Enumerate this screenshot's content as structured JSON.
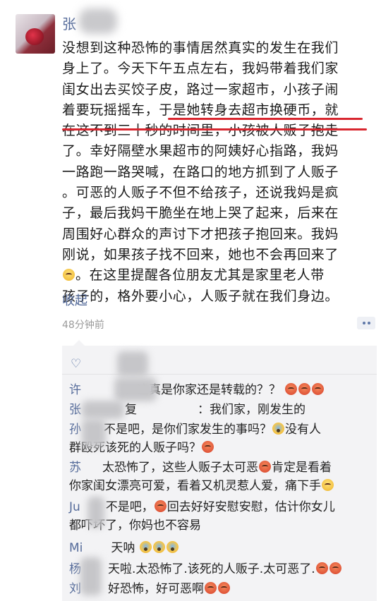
{
  "post": {
    "author_char": "张",
    "lines": [
      "没想到这种恐怖的事情居然真实的发生在我们",
      "身上了。今天下午五点左右，我妈带着我们家",
      "闺女出去买饺子皮，路过一家超市，小孩子闹",
      "着要玩摇摇车，于是她转身去超市换硬币，就",
      "在这不到三十秒的时间里，小孩被人贩子抱走",
      "了。幸好隔壁水果超市的阿姨好心指路，我妈",
      "一路跑一路哭喊，在路口的地方抓到了人贩子",
      "。可恶的人贩子不但不给孩子，还说我妈是疯",
      "子，最后我妈干脆坐在地上哭了起来，后来在",
      "周围好心群众的声讨下才把孩子抱回来。我妈",
      "刚说，如果孩子找不回来，她也不会再回来了",
      "。在这里提醒各位朋友尤其是家里老人带",
      "孩子的，格外要小心，人贩子就在我们身边。"
    ],
    "collapse": "收起",
    "time": "48分钟前"
  },
  "comments": [
    {
      "name": "许",
      "text": "：这真是你家还是转载的？？"
    },
    {
      "name": "张",
      "reply": "复",
      "text": "：我们家，刚发生的"
    },
    {
      "name": "孙",
      "text": "不是吧，是你们家发生的事吗？"
    },
    {
      "name": "",
      "text": "群殴死该死的人贩子吗？"
    },
    {
      "name": "苏",
      "text": "太恐怖了，这些人贩子太可恶"
    },
    {
      "name": "",
      "text": "肯定是看着"
    },
    {
      "name": "",
      "text": "你家闺女漂亮可爱，看着又机灵惹人爱，痛下手"
    },
    {
      "name": "Ju",
      "text": "不是吧，"
    },
    {
      "name": "",
      "text": "回去好好安慰安慰，估计你女儿"
    },
    {
      "name": "",
      "text": "都吓坏了，你妈也不容易"
    },
    {
      "name": "Mi",
      "text": "天呐"
    },
    {
      "name": "杨",
      "text": "天啦.太恐怖了.该死的人贩子.太可恶了."
    },
    {
      "name": "刘",
      "text": "好恐怖，好可恶啊"
    }
  ],
  "extras": {
    "no_person": "没有人"
  },
  "colors": {
    "link": "#556b9a",
    "underline": "#d8262f",
    "comment_bg": "#f3f3f5"
  }
}
